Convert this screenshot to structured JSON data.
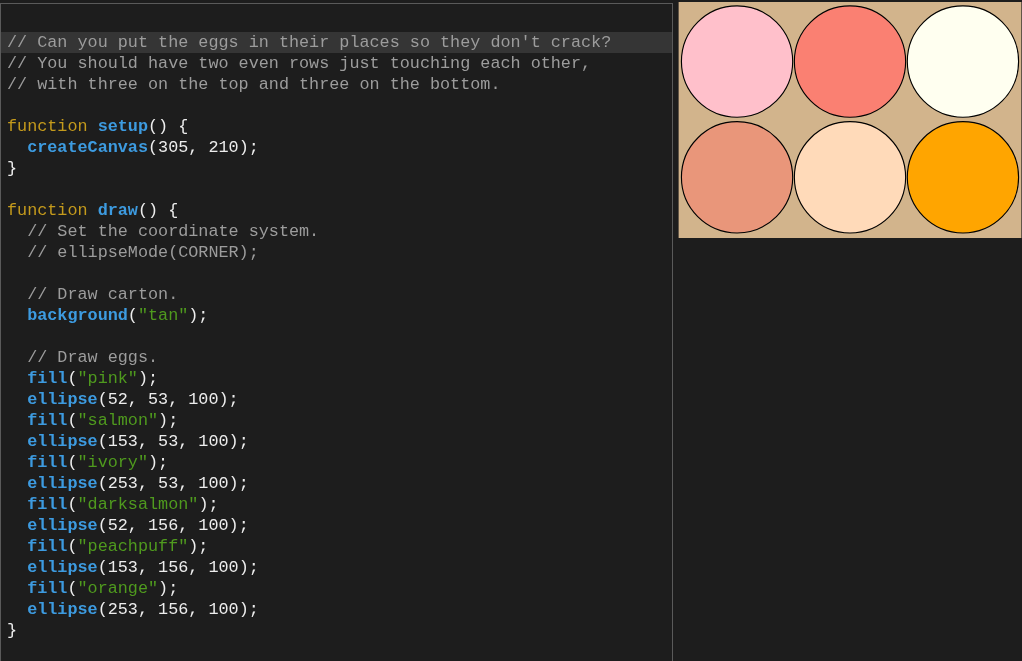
{
  "editor": {
    "lines": [
      {
        "current": true,
        "tokens": [
          {
            "kind": "comment",
            "text": "// Can you put the eggs in their places so they don't crack?"
          }
        ]
      },
      {
        "current": false,
        "tokens": [
          {
            "kind": "comment",
            "text": "// You should have two even rows just touching each other,"
          }
        ]
      },
      {
        "current": false,
        "tokens": [
          {
            "kind": "comment",
            "text": "// with three on the top and three on the bottom."
          }
        ]
      },
      {
        "current": false
      },
      {
        "current": false,
        "tokens": [
          {
            "kind": "keyword",
            "text": "function "
          },
          {
            "kind": "call",
            "text": "setup"
          },
          {
            "kind": "plain",
            "text": "() {"
          }
        ]
      },
      {
        "current": false,
        "tokens": [
          {
            "kind": "call",
            "text": "  createCanvas"
          },
          {
            "kind": "plain",
            "text": "(305, 210);"
          }
        ]
      },
      {
        "current": false,
        "tokens": [
          {
            "kind": "plain",
            "text": "}"
          }
        ]
      },
      {
        "current": false
      },
      {
        "current": false,
        "tokens": [
          {
            "kind": "keyword",
            "text": "function "
          },
          {
            "kind": "call",
            "text": "draw"
          },
          {
            "kind": "plain",
            "text": "() {"
          }
        ]
      },
      {
        "current": false,
        "tokens": [
          {
            "kind": "comment",
            "text": "  // Set the coordinate system."
          }
        ]
      },
      {
        "current": false,
        "tokens": [
          {
            "kind": "comment",
            "text": "  // ellipseMode(CORNER);"
          }
        ]
      },
      {
        "current": false
      },
      {
        "current": false,
        "tokens": [
          {
            "kind": "comment",
            "text": "  // Draw carton."
          }
        ]
      },
      {
        "current": false,
        "tokens": [
          {
            "kind": "call",
            "text": "  background"
          },
          {
            "kind": "plain",
            "text": "("
          },
          {
            "kind": "string",
            "text": "\"tan\""
          },
          {
            "kind": "plain",
            "text": ");"
          }
        ]
      },
      {
        "current": false
      },
      {
        "current": false,
        "tokens": [
          {
            "kind": "comment",
            "text": "  // Draw eggs."
          }
        ]
      },
      {
        "current": false,
        "tokens": [
          {
            "kind": "call",
            "text": "  fill"
          },
          {
            "kind": "plain",
            "text": "("
          },
          {
            "kind": "string",
            "text": "\"pink\""
          },
          {
            "kind": "plain",
            "text": ");"
          }
        ]
      },
      {
        "current": false,
        "tokens": [
          {
            "kind": "call",
            "text": "  ellipse"
          },
          {
            "kind": "plain",
            "text": "(52, 53, 100);"
          }
        ]
      },
      {
        "current": false,
        "tokens": [
          {
            "kind": "call",
            "text": "  fill"
          },
          {
            "kind": "plain",
            "text": "("
          },
          {
            "kind": "string",
            "text": "\"salmon\""
          },
          {
            "kind": "plain",
            "text": ");"
          }
        ]
      },
      {
        "current": false,
        "tokens": [
          {
            "kind": "call",
            "text": "  ellipse"
          },
          {
            "kind": "plain",
            "text": "(153, 53, 100);"
          }
        ]
      },
      {
        "current": false,
        "tokens": [
          {
            "kind": "call",
            "text": "  fill"
          },
          {
            "kind": "plain",
            "text": "("
          },
          {
            "kind": "string",
            "text": "\"ivory\""
          },
          {
            "kind": "plain",
            "text": ");"
          }
        ]
      },
      {
        "current": false,
        "tokens": [
          {
            "kind": "call",
            "text": "  ellipse"
          },
          {
            "kind": "plain",
            "text": "(253, 53, 100);"
          }
        ]
      },
      {
        "current": false,
        "tokens": [
          {
            "kind": "call",
            "text": "  fill"
          },
          {
            "kind": "plain",
            "text": "("
          },
          {
            "kind": "string",
            "text": "\"darksalmon\""
          },
          {
            "kind": "plain",
            "text": ");"
          }
        ]
      },
      {
        "current": false,
        "tokens": [
          {
            "kind": "call",
            "text": "  ellipse"
          },
          {
            "kind": "plain",
            "text": "(52, 156, 100);"
          }
        ]
      },
      {
        "current": false,
        "tokens": [
          {
            "kind": "call",
            "text": "  fill"
          },
          {
            "kind": "plain",
            "text": "("
          },
          {
            "kind": "string",
            "text": "\"peachpuff\""
          },
          {
            "kind": "plain",
            "text": ");"
          }
        ]
      },
      {
        "current": false,
        "tokens": [
          {
            "kind": "call",
            "text": "  ellipse"
          },
          {
            "kind": "plain",
            "text": "(153, 156, 100);"
          }
        ]
      },
      {
        "current": false,
        "tokens": [
          {
            "kind": "call",
            "text": "  fill"
          },
          {
            "kind": "plain",
            "text": "("
          },
          {
            "kind": "string",
            "text": "\"orange\""
          },
          {
            "kind": "plain",
            "text": ");"
          }
        ]
      },
      {
        "current": false,
        "tokens": [
          {
            "kind": "call",
            "text": "  ellipse"
          },
          {
            "kind": "plain",
            "text": "(253, 156, 100);"
          }
        ]
      },
      {
        "current": false,
        "tokens": [
          {
            "kind": "plain",
            "text": "}"
          }
        ]
      }
    ]
  },
  "canvas": {
    "color": "#d2b48c",
    "eggs": [
      {
        "color": "#ffc0cb"
      },
      {
        "color": "#fa8072"
      },
      {
        "color": "#fffff0"
      },
      {
        "color": "#e9967a"
      },
      {
        "color": "#ffdab9"
      },
      {
        "color": "#ffa500"
      }
    ]
  }
}
